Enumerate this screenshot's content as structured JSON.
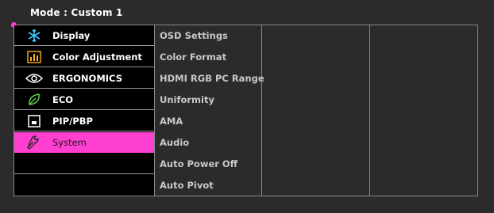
{
  "header": {
    "mode_title": "Mode : Custom 1"
  },
  "colors": {
    "accent": "#ff3fd0",
    "panel_bg": "#2b2b2b",
    "menu_bg": "#000000",
    "border": "#8a8a8a"
  },
  "main_menu": {
    "items": [
      {
        "label": "Display",
        "icon": "display-snowflake-icon",
        "selected": false
      },
      {
        "label": "Color Adjustment",
        "icon": "color-bars-icon",
        "selected": false
      },
      {
        "label": "ERGONOMICS",
        "icon": "eye-icon",
        "selected": false
      },
      {
        "label": "ECO",
        "icon": "leaf-icon",
        "selected": false
      },
      {
        "label": "PIP/PBP",
        "icon": "pip-icon",
        "selected": false
      },
      {
        "label": "System",
        "icon": "wrench-icon",
        "selected": true
      }
    ]
  },
  "submenu": {
    "items": [
      {
        "label": "OSD Settings"
      },
      {
        "label": "Color Format"
      },
      {
        "label": "HDMI RGB PC Range"
      },
      {
        "label": "Uniformity"
      },
      {
        "label": "AMA"
      },
      {
        "label": "Audio"
      },
      {
        "label": "Auto Power Off"
      },
      {
        "label": "Auto Pivot"
      }
    ]
  }
}
